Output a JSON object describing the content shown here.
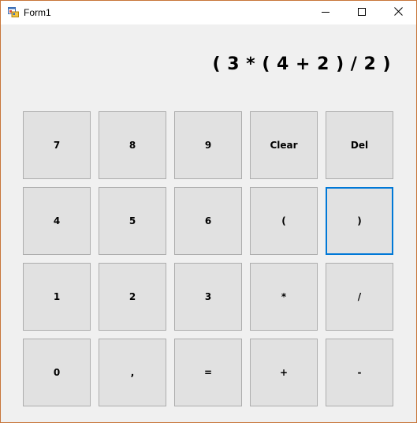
{
  "window": {
    "title": "Form1",
    "icon": "winforms-app-icon",
    "controls": {
      "minimize": "minimize-icon",
      "maximize": "maximize-icon",
      "close": "close-icon"
    }
  },
  "display": {
    "expression": "( 3 * ( 4 + 2 ) / 2 )"
  },
  "keypad": {
    "keys": [
      [
        "7",
        "8",
        "9",
        "Clear",
        "Del"
      ],
      [
        "4",
        "5",
        "6",
        "(",
        ")"
      ],
      [
        "1",
        "2",
        "3",
        "*",
        "/"
      ],
      [
        "0",
        ",",
        "=",
        "+",
        "-"
      ]
    ],
    "focused_key": ")"
  },
  "colors": {
    "focus_border": "#0078d7",
    "button_face": "#e1e1e1",
    "form_background": "#f0f0f0",
    "window_border": "#c8763a"
  }
}
